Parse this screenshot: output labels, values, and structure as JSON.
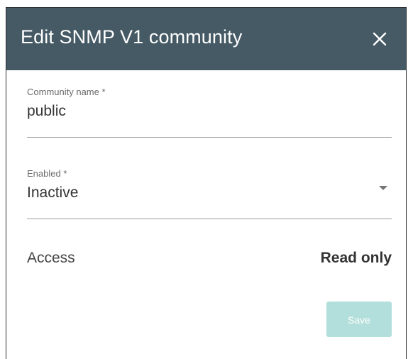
{
  "dialog": {
    "title": "Edit SNMP V1 community",
    "close_icon": "close-icon"
  },
  "fields": {
    "community_name": {
      "label": "Community name *",
      "value": "public"
    },
    "enabled": {
      "label": "Enabled *",
      "value": "Inactive",
      "icon": "dropdown-arrow-icon"
    }
  },
  "access": {
    "label": "Access",
    "value": "Read only"
  },
  "actions": {
    "save_label": "Save"
  },
  "colors": {
    "header_bg": "#455a64",
    "header_text": "#ffffff",
    "save_disabled_bg": "#b2dfdb"
  }
}
